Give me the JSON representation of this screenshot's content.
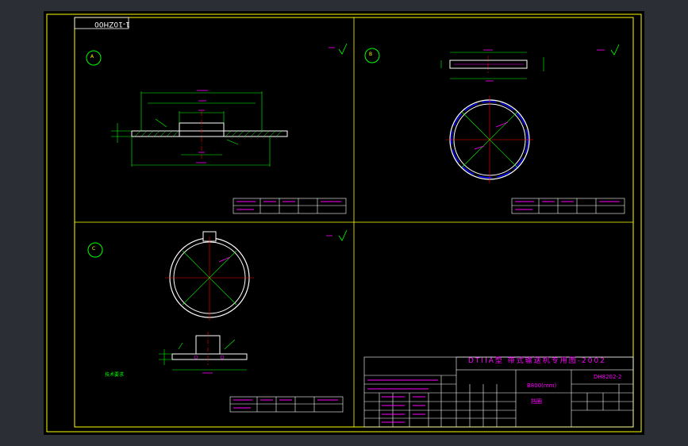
{
  "drawing": {
    "code": "1-10ZH00",
    "title_block_title": "DTIIA型  带式输送机专用图-2002",
    "spec": "B800(mm)",
    "part_name": "挡圈",
    "drawing_number": "DH8202-2",
    "note": "技术要求",
    "views": [
      {
        "label": "A",
        "finish": "Ra6.3"
      },
      {
        "label": "B",
        "finish": "Ra6.3"
      },
      {
        "label": "C",
        "finish": "Ra6.3"
      }
    ],
    "colors": {
      "background": "#000000",
      "frame": "#ffff00",
      "outline": "#ffffff",
      "dimension": "#00ff00",
      "center_line": "#ff0000",
      "text": "#ff00ff",
      "hidden": "#0000ff"
    }
  }
}
